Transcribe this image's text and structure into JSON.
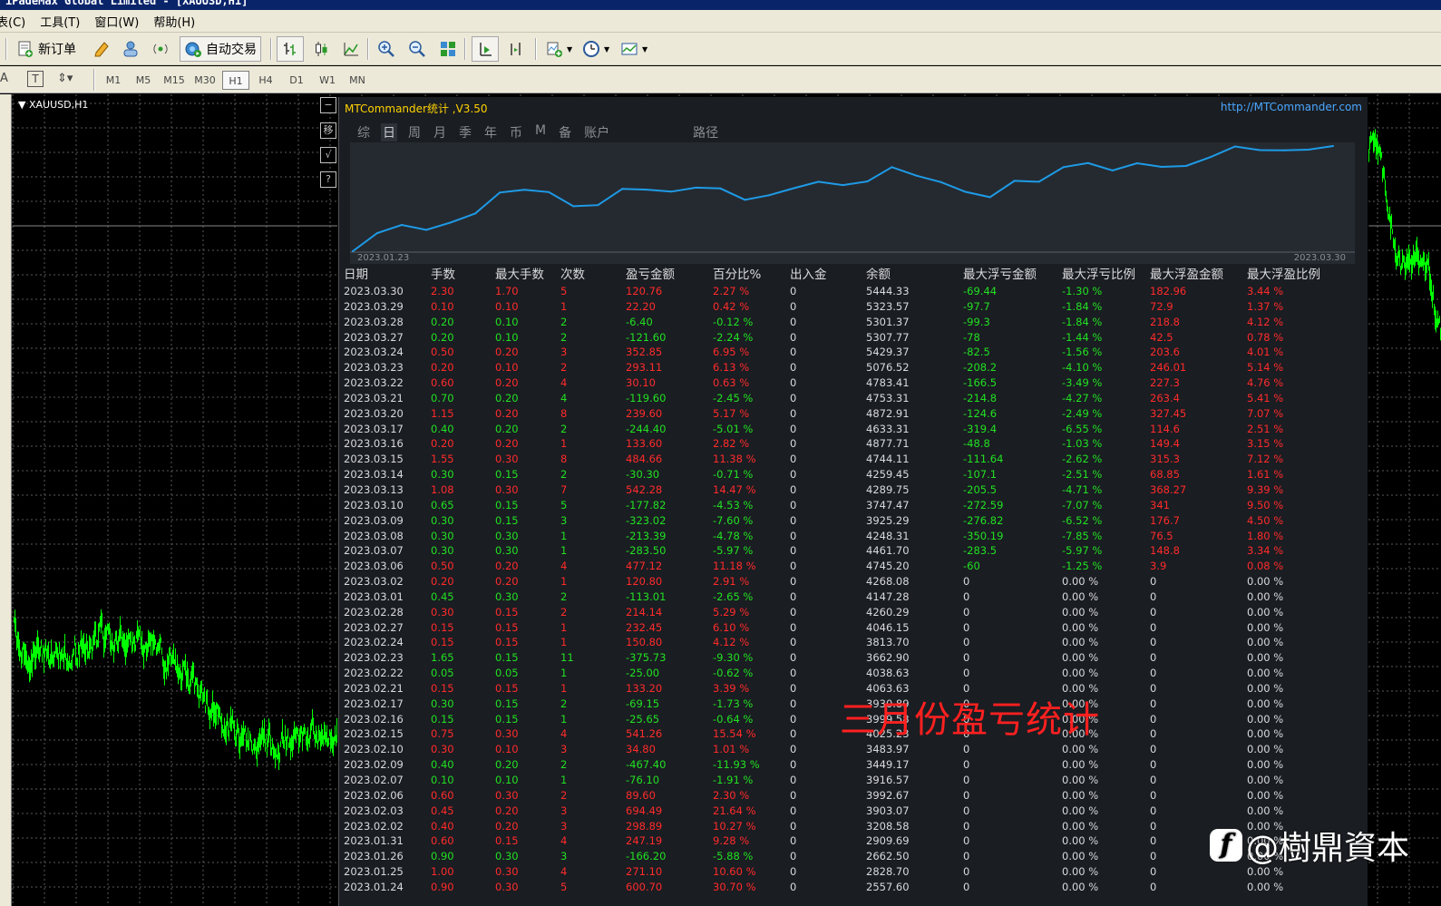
{
  "window": {
    "title": "iPadeMax Global Limited - [XAUUSD,H1]"
  },
  "menu": [
    "表(C)",
    "工具(T)",
    "窗口(W)",
    "帮助(H)"
  ],
  "toolbar": {
    "new_order": "新订单",
    "auto_trade": "自动交易"
  },
  "timeframes": [
    "M1",
    "M5",
    "M15",
    "M30",
    "H1",
    "H4",
    "D1",
    "W1",
    "MN"
  ],
  "active_timeframe": "H1",
  "chart": {
    "symbol": "XAUUSD,H1",
    "up_color": "#00ff00",
    "grid_color": "#5a5a5a"
  },
  "panel": {
    "title": "MTCommander统计 ,V3.50",
    "link": "http://MTCommander.com",
    "tabs": [
      "综",
      "日",
      "周",
      "月",
      "季",
      "年",
      "币",
      "M",
      "备",
      "账户",
      "路径"
    ],
    "active_tab": "日",
    "side_buttons": [
      "−",
      "移",
      "√",
      "?"
    ]
  },
  "chart_data": {
    "type": "line",
    "x_start_label": "2023.01.23",
    "x_end_label": "2023.03.30",
    "series_color": "#1e9be6",
    "grid": false,
    "x": [
      "2023.01.23",
      "2023.01.24",
      "2023.01.25",
      "2023.01.26",
      "2023.01.31",
      "2023.02.02",
      "2023.02.03",
      "2023.02.06",
      "2023.02.07",
      "2023.02.09",
      "2023.02.10",
      "2023.02.15",
      "2023.02.16",
      "2023.02.17",
      "2023.02.21",
      "2023.02.22",
      "2023.02.23",
      "2023.02.24",
      "2023.02.27",
      "2023.02.28",
      "2023.03.01",
      "2023.03.02",
      "2023.03.06",
      "2023.03.07",
      "2023.03.08",
      "2023.03.09",
      "2023.03.10",
      "2023.03.13",
      "2023.03.14",
      "2023.03.15",
      "2023.03.16",
      "2023.03.17",
      "2023.03.20",
      "2023.03.21",
      "2023.03.22",
      "2023.03.23",
      "2023.03.24",
      "2023.03.27",
      "2023.03.28",
      "2023.03.29",
      "2023.03.30"
    ],
    "values": [
      1956.9,
      2557.6,
      2828.7,
      2662.5,
      2909.69,
      3208.58,
      3903.07,
      3992.67,
      3916.57,
      3449.17,
      3483.97,
      4025.23,
      3999.58,
      3930.89,
      4063.63,
      4038.63,
      3662.9,
      3813.7,
      4046.15,
      4260.29,
      4147.28,
      4268.08,
      4745.2,
      4461.7,
      4248.31,
      3925.29,
      3747.47,
      4289.75,
      4259.45,
      4744.11,
      4877.71,
      4633.31,
      4872.91,
      4753.31,
      4783.41,
      5076.52,
      5429.37,
      5307.77,
      5301.37,
      5323.57,
      5444.33
    ]
  },
  "table": {
    "headers": [
      "日期",
      "手数",
      "最大手数",
      "次数",
      "盈亏金额",
      "百分比%",
      "出入金",
      "余额",
      "最大浮亏金额",
      "最大浮亏比例",
      "最大浮盈金额",
      "最大浮盈比例"
    ],
    "rows": [
      [
        "2023.03.30",
        "2.30",
        "1.70",
        "5",
        "120.76",
        "2.27 %",
        "0",
        "5444.33",
        "-69.44",
        "-1.30 %",
        "182.96",
        "3.44 %"
      ],
      [
        "2023.03.29",
        "0.10",
        "0.10",
        "1",
        "22.20",
        "0.42 %",
        "0",
        "5323.57",
        "-97.7",
        "-1.84 %",
        "72.9",
        "1.37 %"
      ],
      [
        "2023.03.28",
        "0.20",
        "0.10",
        "2",
        "-6.40",
        "-0.12 %",
        "0",
        "5301.37",
        "-99.3",
        "-1.84 %",
        "218.8",
        "4.12 %"
      ],
      [
        "2023.03.27",
        "0.20",
        "0.10",
        "2",
        "-121.60",
        "-2.24 %",
        "0",
        "5307.77",
        "-78",
        "-1.44 %",
        "42.5",
        "0.78 %"
      ],
      [
        "2023.03.24",
        "0.50",
        "0.20",
        "3",
        "352.85",
        "6.95 %",
        "0",
        "5429.37",
        "-82.5",
        "-1.56 %",
        "203.6",
        "4.01 %"
      ],
      [
        "2023.03.23",
        "0.20",
        "0.10",
        "2",
        "293.11",
        "6.13 %",
        "0",
        "5076.52",
        "-208.2",
        "-4.10 %",
        "246.01",
        "5.14 %"
      ],
      [
        "2023.03.22",
        "0.60",
        "0.20",
        "4",
        "30.10",
        "0.63 %",
        "0",
        "4783.41",
        "-166.5",
        "-3.49 %",
        "227.3",
        "4.76 %"
      ],
      [
        "2023.03.21",
        "0.70",
        "0.20",
        "4",
        "-119.60",
        "-2.45 %",
        "0",
        "4753.31",
        "-214.8",
        "-4.27 %",
        "263.4",
        "5.41 %"
      ],
      [
        "2023.03.20",
        "1.15",
        "0.20",
        "8",
        "239.60",
        "5.17 %",
        "0",
        "4872.91",
        "-124.6",
        "-2.49 %",
        "327.45",
        "7.07 %"
      ],
      [
        "2023.03.17",
        "0.40",
        "0.20",
        "2",
        "-244.40",
        "-5.01 %",
        "0",
        "4633.31",
        "-319.4",
        "-6.55 %",
        "114.6",
        "2.51 %"
      ],
      [
        "2023.03.16",
        "0.20",
        "0.20",
        "1",
        "133.60",
        "2.82 %",
        "0",
        "4877.71",
        "-48.8",
        "-1.03 %",
        "149.4",
        "3.15 %"
      ],
      [
        "2023.03.15",
        "1.55",
        "0.30",
        "8",
        "484.66",
        "11.38 %",
        "0",
        "4744.11",
        "-111.64",
        "-2.62 %",
        "315.3",
        "7.12 %"
      ],
      [
        "2023.03.14",
        "0.30",
        "0.15",
        "2",
        "-30.30",
        "-0.71 %",
        "0",
        "4259.45",
        "-107.1",
        "-2.51 %",
        "68.85",
        "1.61 %"
      ],
      [
        "2023.03.13",
        "1.08",
        "0.30",
        "7",
        "542.28",
        "14.47 %",
        "0",
        "4289.75",
        "-205.5",
        "-4.71 %",
        "368.27",
        "9.39 %"
      ],
      [
        "2023.03.10",
        "0.65",
        "0.15",
        "5",
        "-177.82",
        "-4.53 %",
        "0",
        "3747.47",
        "-272.59",
        "-7.07 %",
        "341",
        "9.50 %"
      ],
      [
        "2023.03.09",
        "0.30",
        "0.15",
        "3",
        "-323.02",
        "-7.60 %",
        "0",
        "3925.29",
        "-276.82",
        "-6.52 %",
        "176.7",
        "4.50 %"
      ],
      [
        "2023.03.08",
        "0.30",
        "0.30",
        "1",
        "-213.39",
        "-4.78 %",
        "0",
        "4248.31",
        "-350.19",
        "-7.85 %",
        "76.5",
        "1.80 %"
      ],
      [
        "2023.03.07",
        "0.30",
        "0.30",
        "1",
        "-283.50",
        "-5.97 %",
        "0",
        "4461.70",
        "-283.5",
        "-5.97 %",
        "148.8",
        "3.34 %"
      ],
      [
        "2023.03.06",
        "0.50",
        "0.20",
        "4",
        "477.12",
        "11.18 %",
        "0",
        "4745.20",
        "-60",
        "-1.25 %",
        "3.9",
        "0.08 %"
      ],
      [
        "2023.03.02",
        "0.20",
        "0.20",
        "1",
        "120.80",
        "2.91 %",
        "0",
        "4268.08",
        "0",
        "0.00 %",
        "0",
        "0.00 %"
      ],
      [
        "2023.03.01",
        "0.45",
        "0.30",
        "2",
        "-113.01",
        "-2.65 %",
        "0",
        "4147.28",
        "0",
        "0.00 %",
        "0",
        "0.00 %"
      ],
      [
        "2023.02.28",
        "0.30",
        "0.15",
        "2",
        "214.14",
        "5.29 %",
        "0",
        "4260.29",
        "0",
        "0.00 %",
        "0",
        "0.00 %"
      ],
      [
        "2023.02.27",
        "0.15",
        "0.15",
        "1",
        "232.45",
        "6.10 %",
        "0",
        "4046.15",
        "0",
        "0.00 %",
        "0",
        "0.00 %"
      ],
      [
        "2023.02.24",
        "0.15",
        "0.15",
        "1",
        "150.80",
        "4.12 %",
        "0",
        "3813.70",
        "0",
        "0.00 %",
        "0",
        "0.00 %"
      ],
      [
        "2023.02.23",
        "1.65",
        "0.15",
        "11",
        "-375.73",
        "-9.30 %",
        "0",
        "3662.90",
        "0",
        "0.00 %",
        "0",
        "0.00 %"
      ],
      [
        "2023.02.22",
        "0.05",
        "0.05",
        "1",
        "-25.00",
        "-0.62 %",
        "0",
        "4038.63",
        "0",
        "0.00 %",
        "0",
        "0.00 %"
      ],
      [
        "2023.02.21",
        "0.15",
        "0.15",
        "1",
        "133.20",
        "3.39 %",
        "0",
        "4063.63",
        "0",
        "0.00 %",
        "0",
        "0.00 %"
      ],
      [
        "2023.02.17",
        "0.30",
        "0.15",
        "2",
        "-69.15",
        "-1.73 %",
        "0",
        "3930.89",
        "0",
        "0.00 %",
        "0",
        "0.00 %"
      ],
      [
        "2023.02.16",
        "0.15",
        "0.15",
        "1",
        "-25.65",
        "-0.64 %",
        "0",
        "3999.58",
        "0",
        "0.00 %",
        "0",
        "0.00 %"
      ],
      [
        "2023.02.15",
        "0.75",
        "0.30",
        "4",
        "541.26",
        "15.54 %",
        "0",
        "4025.23",
        "0",
        "0.00 %",
        "0",
        "0.00 %"
      ],
      [
        "2023.02.10",
        "0.30",
        "0.10",
        "3",
        "34.80",
        "1.01 %",
        "0",
        "3483.97",
        "0",
        "0.00 %",
        "0",
        "0.00 %"
      ],
      [
        "2023.02.09",
        "0.40",
        "0.20",
        "2",
        "-467.40",
        "-11.93 %",
        "0",
        "3449.17",
        "0",
        "0.00 %",
        "0",
        "0.00 %"
      ],
      [
        "2023.02.07",
        "0.10",
        "0.10",
        "1",
        "-76.10",
        "-1.91 %",
        "0",
        "3916.57",
        "0",
        "0.00 %",
        "0",
        "0.00 %"
      ],
      [
        "2023.02.06",
        "0.60",
        "0.30",
        "2",
        "89.60",
        "2.30 %",
        "0",
        "3992.67",
        "0",
        "0.00 %",
        "0",
        "0.00 %"
      ],
      [
        "2023.02.03",
        "0.45",
        "0.20",
        "3",
        "694.49",
        "21.64 %",
        "0",
        "3903.07",
        "0",
        "0.00 %",
        "0",
        "0.00 %"
      ],
      [
        "2023.02.02",
        "0.40",
        "0.20",
        "3",
        "298.89",
        "10.27 %",
        "0",
        "3208.58",
        "0",
        "0.00 %",
        "0",
        "0.00 %"
      ],
      [
        "2023.01.31",
        "0.60",
        "0.15",
        "4",
        "247.19",
        "9.28 %",
        "0",
        "2909.69",
        "0",
        "0.00 %",
        "0",
        "0.00 %"
      ],
      [
        "2023.01.26",
        "0.90",
        "0.30",
        "3",
        "-166.20",
        "-5.88 %",
        "0",
        "2662.50",
        "0",
        "0.00 %",
        "0",
        "0.00 %"
      ],
      [
        "2023.01.25",
        "1.00",
        "0.30",
        "4",
        "271.10",
        "10.60 %",
        "0",
        "2828.70",
        "0",
        "0.00 %",
        "0",
        "0.00 %"
      ],
      [
        "2023.01.24",
        "0.90",
        "0.30",
        "5",
        "600.70",
        "30.70 %",
        "0",
        "2557.60",
        "0",
        "0.00 %",
        "0",
        "0.00 %"
      ]
    ]
  },
  "overlay_text": "三月份盈亏统计",
  "watermark": {
    "logo": "f",
    "text": "@樹鼎資本"
  },
  "colors": {
    "profit": "#ff2b2b",
    "loss": "#22e022",
    "panel_bg": "#1a1d22",
    "title": "#ffd200",
    "link": "#4aa8ff"
  }
}
